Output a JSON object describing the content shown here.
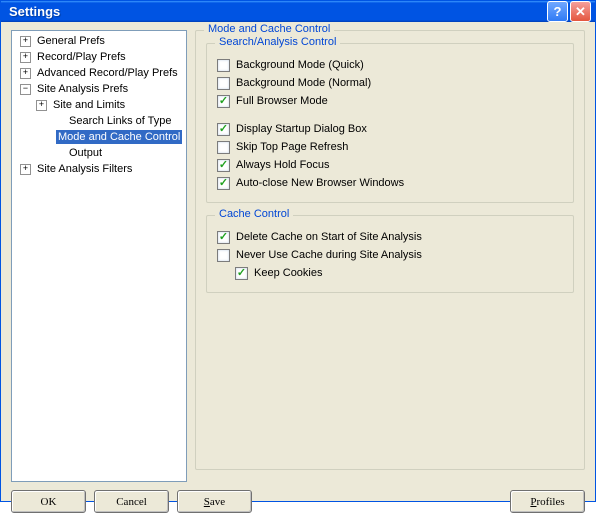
{
  "window": {
    "title": "Settings"
  },
  "tree": {
    "items": [
      {
        "label": "General Prefs",
        "expand": "plus"
      },
      {
        "label": "Record/Play Prefs",
        "expand": "plus"
      },
      {
        "label": "Advanced Record/Play Prefs",
        "expand": "plus"
      },
      {
        "label": "Site Analysis Prefs",
        "expand": "minus",
        "children": [
          {
            "label": "Site and Limits",
            "expand": "plus"
          },
          {
            "label": "Search Links of Type"
          },
          {
            "label": "Mode and Cache Control",
            "selected": true
          },
          {
            "label": "Output"
          }
        ]
      },
      {
        "label": "Site Analysis Filters",
        "expand": "plus"
      }
    ]
  },
  "panel": {
    "outer_title": "Mode and Cache Control",
    "search_group": {
      "title": "Search/Analysis Control",
      "opts1": [
        {
          "label": "Background Mode (Quick)",
          "checked": false
        },
        {
          "label": "Background Mode (Normal)",
          "checked": false
        },
        {
          "label": "Full Browser Mode",
          "checked": true
        }
      ],
      "opts2": [
        {
          "label": "Display Startup Dialog Box",
          "checked": true
        },
        {
          "label": "Skip Top Page Refresh",
          "checked": false
        },
        {
          "label": "Always Hold Focus",
          "checked": true
        },
        {
          "label": "Auto-close New Browser Windows",
          "checked": true
        }
      ]
    },
    "cache_group": {
      "title": "Cache Control",
      "opts": [
        {
          "label": "Delete Cache on Start of Site Analysis",
          "checked": true
        },
        {
          "label": "Never Use Cache during Site Analysis",
          "checked": false
        }
      ],
      "sub": {
        "label": "Keep Cookies",
        "checked": true
      }
    }
  },
  "buttons": {
    "ok": "OK",
    "cancel": "Cancel",
    "save": "Save",
    "profiles": "Profiles"
  }
}
